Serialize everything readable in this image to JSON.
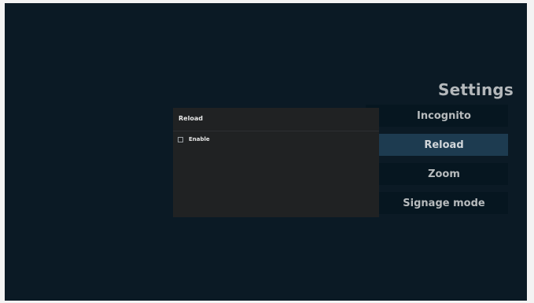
{
  "settings": {
    "title": "Settings",
    "menu_items": [
      {
        "label": "Incognito",
        "selected": false
      },
      {
        "label": "Reload",
        "selected": true
      },
      {
        "label": "Zoom",
        "selected": false
      },
      {
        "label": "Signage mode",
        "selected": false
      }
    ]
  },
  "dialog": {
    "title": "Reload",
    "options": [
      {
        "label": "Enable",
        "checked": false
      }
    ]
  },
  "colors": {
    "background": "#0b1a25",
    "menu_item": "#061620",
    "menu_item_selected": "#1d3b50",
    "dialog": "#202223"
  }
}
